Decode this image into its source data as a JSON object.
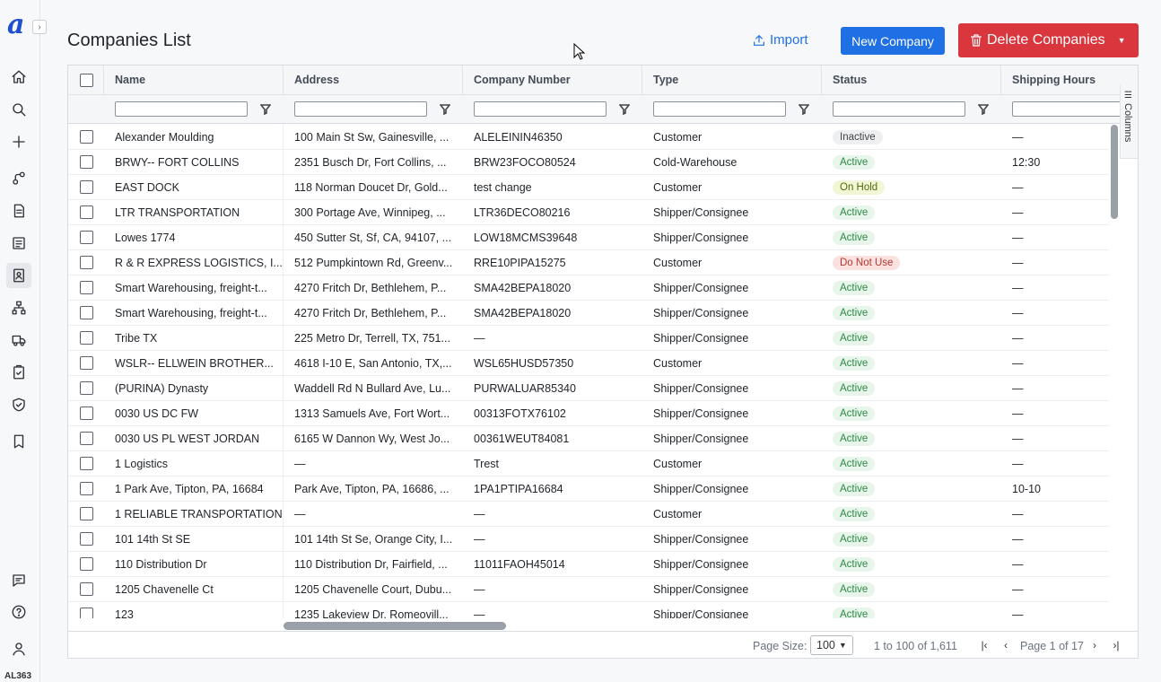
{
  "app": {
    "logo": "a",
    "user_code": "AL363"
  },
  "header": {
    "title": "Companies List",
    "import_label": "Import",
    "new_label": "New Company",
    "delete_label": "Delete Companies"
  },
  "grid": {
    "columns": [
      "Name",
      "Address",
      "Company Number",
      "Type",
      "Status",
      "Shipping Hours"
    ],
    "columns_panel_label": "Columns",
    "rows": [
      {
        "name": "Alexander Moulding",
        "address": "100 Main St Sw, Gainesville, ...",
        "number": "ALELEININ46350",
        "type": "Customer",
        "status": "Inactive",
        "hours": "—"
      },
      {
        "name": "BRWY-- FORT COLLINS",
        "address": "2351 Busch Dr, Fort Collins, ...",
        "number": "BRW23FOCO80524",
        "type": "Cold-Warehouse",
        "status": "Active",
        "hours": "12:30"
      },
      {
        "name": "EAST DOCK",
        "address": "118 Norman Doucet Dr, Gold...",
        "number": "test change",
        "type": "Customer",
        "status": "On Hold",
        "hours": "—"
      },
      {
        "name": "LTR TRANSPORTATION",
        "address": "300 Portage Ave, Winnipeg, ...",
        "number": "LTR36DECO80216",
        "type": "Shipper/Consignee",
        "status": "Active",
        "hours": "—"
      },
      {
        "name": "Lowes 1774",
        "address": "450 Sutter St, Sf, CA, 94107, ...",
        "number": "LOW18MCMS39648",
        "type": "Shipper/Consignee",
        "status": "Active",
        "hours": "—"
      },
      {
        "name": "R & R EXPRESS LOGISTICS, I...",
        "address": "512 Pumpkintown Rd, Greenv...",
        "number": "RRE10PIPA15275",
        "type": "Customer",
        "status": "Do Not Use",
        "hours": "—"
      },
      {
        "name": "Smart Warehousing, freight-t...",
        "address": "4270 Fritch Dr, Bethlehem, P...",
        "number": "SMA42BEPA18020",
        "type": "Shipper/Consignee",
        "status": "Active",
        "hours": "—"
      },
      {
        "name": "Smart Warehousing, freight-t...",
        "address": "4270 Fritch Dr, Bethlehem, P...",
        "number": "SMA42BEPA18020",
        "type": "Shipper/Consignee",
        "status": "Active",
        "hours": "—"
      },
      {
        "name": "Tribe TX",
        "address": "225 Metro Dr, Terrell, TX, 751...",
        "number": "—",
        "type": "Shipper/Consignee",
        "status": "Active",
        "hours": "—"
      },
      {
        "name": "WSLR-- ELLWEIN BROTHER...",
        "address": "4618 I-10 E, San Antonio, TX,...",
        "number": "WSL65HUSD57350",
        "type": "Customer",
        "status": "Active",
        "hours": "—"
      },
      {
        "name": "(PURINA) Dynasty",
        "address": "Waddell Rd N Bullard Ave, Lu...",
        "number": "PURWALUAR85340",
        "type": "Shipper/Consignee",
        "status": "Active",
        "hours": "—"
      },
      {
        "name": "0030 US DC FW",
        "address": "1313 Samuels Ave, Fort Wort...",
        "number": "00313FOTX76102",
        "type": "Shipper/Consignee",
        "status": "Active",
        "hours": "—"
      },
      {
        "name": "0030 US PL WEST JORDAN",
        "address": "6165 W Dannon Wy, West Jo...",
        "number": "00361WEUT84081",
        "type": "Shipper/Consignee",
        "status": "Active",
        "hours": "—"
      },
      {
        "name": "1 Logistics",
        "address": "—",
        "number": "Trest",
        "type": "Customer",
        "status": "Active",
        "hours": "—"
      },
      {
        "name": "1 Park Ave, Tipton, PA, 16684",
        "address": "Park Ave, Tipton, PA, 16686, ...",
        "number": "1PA1PTIPA16684",
        "type": "Shipper/Consignee",
        "status": "Active",
        "hours": "10-10"
      },
      {
        "name": "1 RELIABLE TRANSPORTATION",
        "address": "—",
        "number": "—",
        "type": "Customer",
        "status": "Active",
        "hours": "—"
      },
      {
        "name": "101 14th St SE",
        "address": "101 14th St Se, Orange City, I...",
        "number": "—",
        "type": "Shipper/Consignee",
        "status": "Active",
        "hours": "—"
      },
      {
        "name": "110 Distribution Dr",
        "address": "110 Distribution Dr, Fairfield, ...",
        "number": "11011FAOH45014",
        "type": "Shipper/Consignee",
        "status": "Active",
        "hours": "—"
      },
      {
        "name": "1205 Chavenelle Ct",
        "address": "1205 Chavenelle Court, Dubu...",
        "number": "—",
        "type": "Shipper/Consignee",
        "status": "Active",
        "hours": "—"
      },
      {
        "name": "123",
        "address": "1235 Lakeview Dr, Romeovill...",
        "number": "—",
        "type": "Shipper/Consignee",
        "status": "Active",
        "hours": "—"
      }
    ]
  },
  "footer": {
    "page_size_label": "Page Size:",
    "page_size_value": "100",
    "range_text": "1 to 100 of 1,611",
    "page_text": "Page 1 of 17"
  },
  "colors": {
    "primary": "#1f6fe5",
    "danger": "#d9363e",
    "logo": "#1f4fd1"
  },
  "icons": [
    "home-icon",
    "search-icon",
    "plus-icon",
    "route-icon",
    "document-icon",
    "list-icon",
    "contacts-icon",
    "hierarchy-icon",
    "truck-icon",
    "clipboard-icon",
    "shield-check-icon",
    "bookmark-icon",
    "chat-icon",
    "help-icon",
    "user-icon"
  ]
}
